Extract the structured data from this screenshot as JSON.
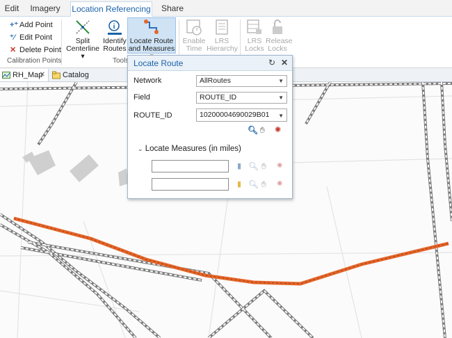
{
  "ribbon_tabs": [
    {
      "label": "Edit"
    },
    {
      "label": "Imagery"
    },
    {
      "label": "Location Referencing"
    },
    {
      "label": "Share"
    }
  ],
  "calibration": {
    "add_point": "Add Point",
    "edit_point": "Edit Point",
    "delete_point": "Delete Point",
    "group_label": "Calibration Points"
  },
  "tools": {
    "split_centerline_l1": "Split",
    "split_centerline_l2": "Centerline",
    "identify_routes_l1": "Identify",
    "identify_routes_l2": "Routes",
    "locate_route_l1": "Locate Route",
    "locate_route_l2": "and Measures",
    "group_label": "Tools"
  },
  "disabled_buttons": {
    "enable_time_l1": "Enable",
    "enable_time_l2": "Time",
    "lrs_hierarchy_l1": "LRS",
    "lrs_hierarchy_l2": "Hierarchy",
    "lrs_locks_l1": "LRS",
    "lrs_locks_l2": "Locks",
    "release_locks_l1": "Release",
    "release_locks_l2": "Locks"
  },
  "doc_tabs": [
    {
      "label": "RH_Map"
    },
    {
      "label": "Catalog"
    }
  ],
  "dialog": {
    "title": "Locate Route",
    "network_label": "Network",
    "network_value": "AllRoutes",
    "field_label": "Field",
    "field_value": "ROUTE_ID",
    "routeid_label": "ROUTE_ID",
    "routeid_value": "10200004690029B01",
    "measures_section": "Locate Measures (in miles)"
  },
  "colors": {
    "accent": "#1a62a8",
    "route_highlight": "#e4662a",
    "selected_button": "#cfe3f5"
  }
}
